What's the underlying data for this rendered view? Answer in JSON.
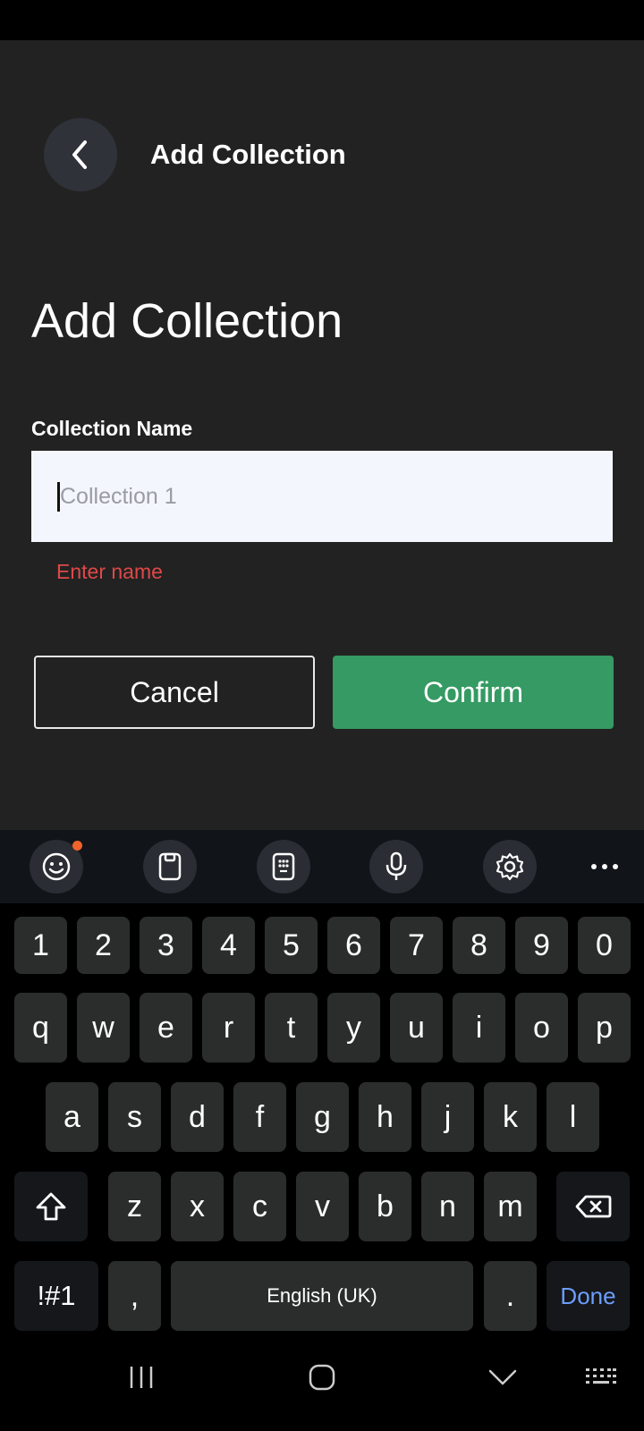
{
  "header": {
    "title": "Add Collection",
    "back_icon": "chevron-left-icon"
  },
  "page": {
    "heading": "Add Collection"
  },
  "form": {
    "label": "Collection Name",
    "placeholder": "Collection 1",
    "value": "",
    "error": "Enter name"
  },
  "actions": {
    "cancel": "Cancel",
    "confirm": "Confirm"
  },
  "colors": {
    "background": "#222222",
    "confirm": "#359a63",
    "error": "#e04848",
    "input_bg": "#f4f6fd",
    "done_key": "#6d9dff"
  },
  "keyboard": {
    "toolbar": [
      "emoji-icon",
      "clipboard-icon",
      "keypad-icon",
      "microphone-icon",
      "settings-icon",
      "more-icon"
    ],
    "row_numbers": [
      "1",
      "2",
      "3",
      "4",
      "5",
      "6",
      "7",
      "8",
      "9",
      "0"
    ],
    "row1": [
      "q",
      "w",
      "e",
      "r",
      "t",
      "y",
      "u",
      "i",
      "o",
      "p"
    ],
    "row2": [
      "a",
      "s",
      "d",
      "f",
      "g",
      "h",
      "j",
      "k",
      "l"
    ],
    "row3": [
      "z",
      "x",
      "c",
      "v",
      "b",
      "n",
      "m"
    ],
    "symbols": "!#1",
    "comma": ",",
    "space": "English (UK)",
    "period": ".",
    "done": "Done"
  },
  "nav": [
    "recents-icon",
    "home-icon",
    "back-down-icon",
    "keyboard-icon"
  ]
}
